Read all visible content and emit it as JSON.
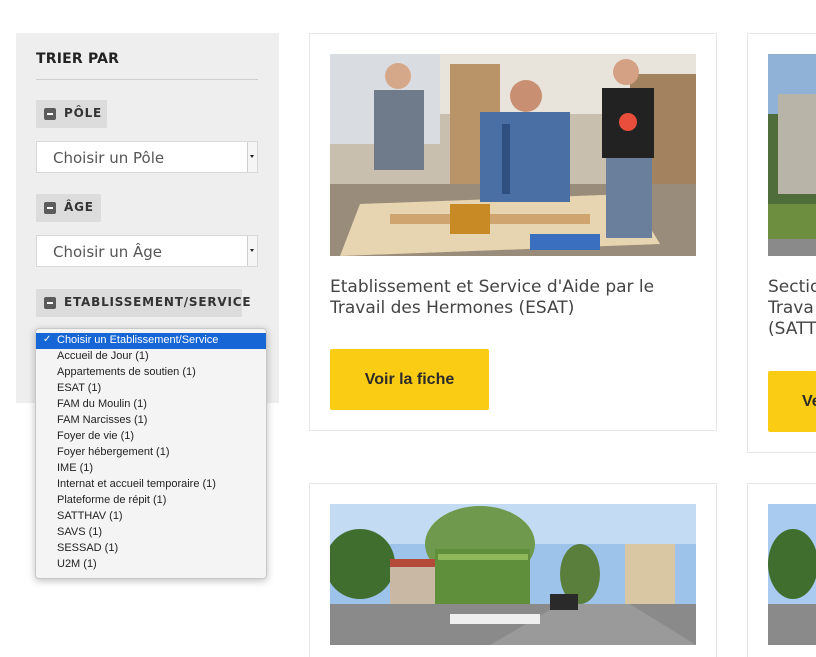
{
  "sidebar": {
    "title": "TRIER PAR",
    "filters": [
      {
        "label": "PÔLE",
        "selected": "Choisir un Pôle"
      },
      {
        "label": "ÂGE",
        "selected": "Choisir un Âge"
      },
      {
        "label": "ETABLISSEMENT/SERVICE"
      }
    ]
  },
  "dropdown": {
    "check": "✓",
    "options": [
      "Choisir un Etablissement/Service",
      "Accueil de Jour (1)",
      "Appartements de soutien (1)",
      "ESAT (1)",
      "FAM du Moulin (1)",
      "FAM Narcisses (1)",
      "Foyer de vie (1)",
      "Foyer hébergement (1)",
      "IME (1)",
      "Internat et accueil temporaire (1)",
      "Plateforme de répit (1)",
      "SATTHAV (1)",
      "SAVS (1)",
      "SESSAD (1)",
      "U2M (1)"
    ]
  },
  "cards": [
    {
      "title_line1": "Etablissement et Service d'Aide par le",
      "title_line2": "Travail des Hermones (ESAT)",
      "button": "Voir la fiche"
    },
    {
      "title_line1": "Sectio",
      "title_line2": "Trava",
      "title_line3": "(SATTI",
      "button": "Ve"
    }
  ]
}
